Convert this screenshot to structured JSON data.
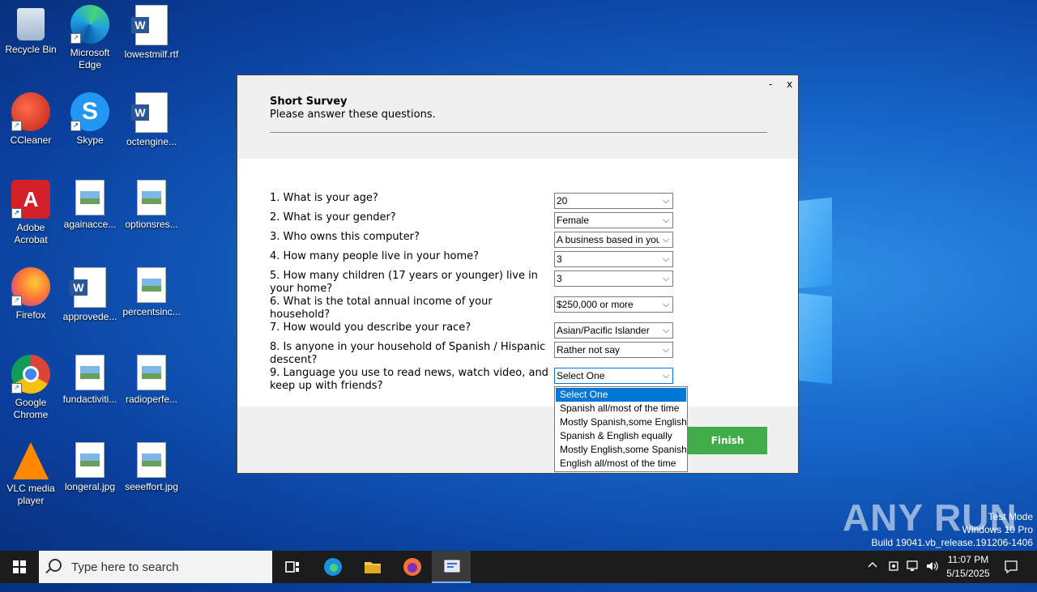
{
  "desktop": {
    "icons": [
      {
        "label": "Recycle Bin"
      },
      {
        "label": "Microsoft Edge"
      },
      {
        "label": "lowestmilf.rtf"
      },
      {
        "label": "CCleaner"
      },
      {
        "label": "Skype"
      },
      {
        "label": "octengine..."
      },
      {
        "label": "Adobe Acrobat"
      },
      {
        "label": "againacce..."
      },
      {
        "label": "optionsres..."
      },
      {
        "label": "Firefox"
      },
      {
        "label": "approvede..."
      },
      {
        "label": "percentsinc..."
      },
      {
        "label": "Google Chrome"
      },
      {
        "label": "fundactiviti..."
      },
      {
        "label": "radioperfe..."
      },
      {
        "label": "VLC media player"
      },
      {
        "label": "longeral.jpg"
      },
      {
        "label": "seeeffort.jpg"
      }
    ]
  },
  "window": {
    "minimize": "-",
    "close": "x",
    "title": "Short Survey",
    "subtitle": "Please answer these questions.",
    "finish_label": "Finish"
  },
  "questions": [
    {
      "text": "1. What is your age?",
      "value": "20"
    },
    {
      "text": "2. What is your gender?",
      "value": "Female"
    },
    {
      "text": "3. Who owns this computer?",
      "value": "A business based in you"
    },
    {
      "text": "4. How many people live in your home?",
      "value": "3"
    },
    {
      "text": "5. How many children (17 years or younger) live in your home?",
      "value": "3"
    },
    {
      "text": "6. What is the total annual income of your household?",
      "value": "$250,000 or more"
    },
    {
      "text": "7. How would you describe your race?",
      "value": "Asian/Pacific Islander"
    },
    {
      "text": "8. Is anyone in your household of Spanish / Hispanic descent?",
      "value": "Rather not say"
    },
    {
      "text": "9. Language you use to read news, watch video, and keep up with friends?",
      "value": "Select One"
    }
  ],
  "dropdown_options": [
    "Select One",
    "Spanish all/most of the time",
    "Mostly Spanish,some English",
    "Spanish & English equally",
    "Mostly English,some Spanish",
    "English all/most of the time"
  ],
  "watermark": {
    "brand": "ANY RUN",
    "line1": "Test Mode",
    "line2": "Windows 10 Pro",
    "line3": "Build 19041.vb_release.191206-1406"
  },
  "taskbar": {
    "search_placeholder": "Type here to search",
    "time": "11:07 PM",
    "date": "5/15/2025"
  },
  "colors": {
    "accent": "#0078d7",
    "finish": "#3fad4a",
    "taskbar": "#1b1b1b"
  }
}
